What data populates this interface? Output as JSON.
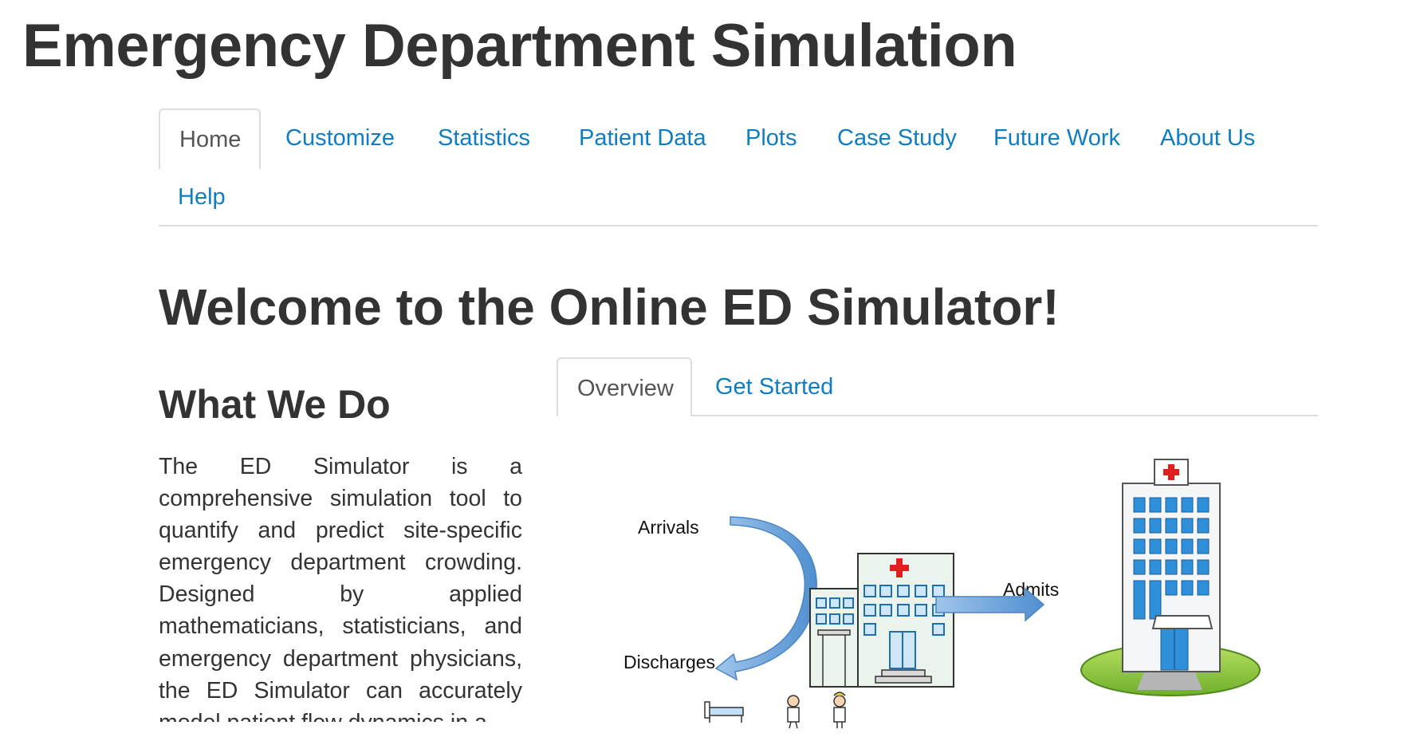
{
  "app": {
    "title": "Emergency Department Simulation"
  },
  "nav": {
    "tabs": [
      {
        "label": "Home",
        "active": true
      },
      {
        "label": "Customize"
      },
      {
        "label": "Statistics"
      },
      {
        "label": "Patient Data"
      },
      {
        "label": "Plots"
      },
      {
        "label": "Case Study"
      },
      {
        "label": "Future Work"
      },
      {
        "label": "About Us"
      },
      {
        "label": "Help"
      }
    ]
  },
  "main": {
    "welcome_heading": "Welcome to the Online ED Simulator!",
    "section_heading": "What We Do",
    "description": "The ED Simulator is a comprehensive simulation tool to quantify and predict site-specific emergency department crowding. Designed by applied mathematicians, statisticians, and emergency department physicians, the ED Simulator can accurately model patient flow dynamics in a",
    "subtabs": [
      {
        "label": "Overview",
        "active": true
      },
      {
        "label": "Get Started"
      }
    ]
  },
  "diagram": {
    "arrivals_label": "Arrivals",
    "discharges_label": "Discharges",
    "admits_label": "Admits"
  },
  "colors": {
    "link": "#0f7dc2",
    "heading_text": "#333333",
    "arrow_blue": "#5b9bd5",
    "cross_red": "#e02020",
    "window_blue": "#2f8fd8",
    "lawn_green": "#8cc63f"
  }
}
